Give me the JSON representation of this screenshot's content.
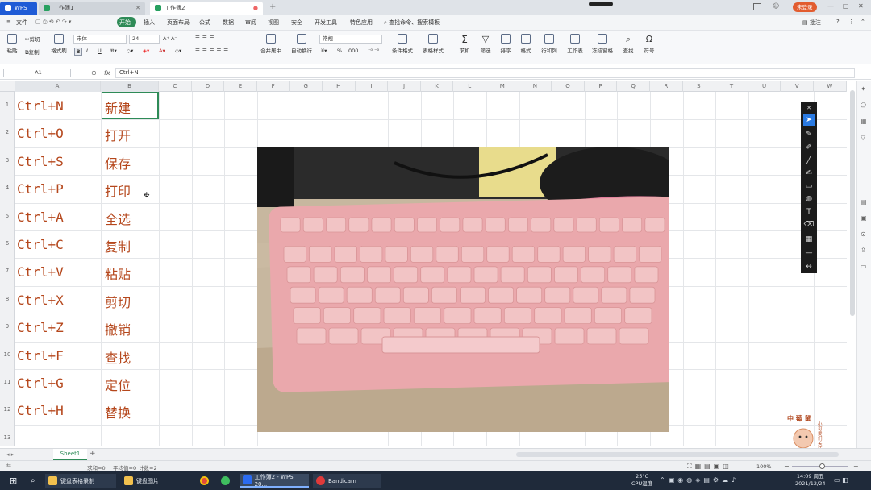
{
  "titlebar": {
    "app_tab": "WPS",
    "doc_tab1": "工作簿1",
    "doc_tab2": "工作簿2",
    "new_tab": "+",
    "unregistered": "未登录"
  },
  "menubar": {
    "file": "文件",
    "items": [
      "开始",
      "插入",
      "页面布局",
      "公式",
      "数据",
      "审阅",
      "视图",
      "安全",
      "开发工具",
      "特色应用"
    ],
    "search": "查找命令、搜索模板",
    "comment": "批注",
    "help": "?"
  },
  "ribbon": {
    "paste": "粘贴",
    "cut": "剪切",
    "copy": "复制",
    "format_painter": "格式刷",
    "font_name": "宋体",
    "font_size": "24",
    "bold": "B",
    "italic": "I",
    "underline": "U",
    "merge_center": "合并居中",
    "wrap": "自动换行",
    "number_format": "常规",
    "currency": "¥",
    "percent": "%",
    "thousands": "000",
    "cond_format": "条件格式",
    "table_style": "表格样式",
    "sum": "求和",
    "filter": "筛选",
    "sort": "排序",
    "format": "格式",
    "rowcol": "行和列",
    "worksheet": "工作表",
    "freeze": "冻结窗格",
    "find": "查找",
    "symbol": "符号"
  },
  "formulabar": {
    "name_box": "A1",
    "fx": "fx",
    "content": "Ctrl+N"
  },
  "columns": [
    "A",
    "B",
    "C",
    "D",
    "E",
    "F",
    "G",
    "H",
    "I",
    "J",
    "K",
    "L",
    "M",
    "N",
    "O",
    "P",
    "Q",
    "R",
    "S",
    "T",
    "U",
    "V",
    "W"
  ],
  "rows": [
    {
      "num": "1",
      "a": "Ctrl+N",
      "b": "新建"
    },
    {
      "num": "2",
      "a": "Ctrl+O",
      "b": "打开"
    },
    {
      "num": "3",
      "a": "Ctrl+S",
      "b": "保存"
    },
    {
      "num": "4",
      "a": "Ctrl+P",
      "b": "打印"
    },
    {
      "num": "5",
      "a": "Ctrl+A",
      "b": "全选"
    },
    {
      "num": "6",
      "a": "Ctrl+C",
      "b": "复制"
    },
    {
      "num": "7",
      "a": "Ctrl+V",
      "b": "粘贴"
    },
    {
      "num": "8",
      "a": "Ctrl+X",
      "b": "剪切"
    },
    {
      "num": "9",
      "a": "Ctrl+Z",
      "b": "撤销"
    },
    {
      "num": "10",
      "a": "Ctrl+F",
      "b": "查找"
    },
    {
      "num": "11",
      "a": "Ctrl+G",
      "b": "定位"
    },
    {
      "num": "12",
      "a": "Ctrl+H",
      "b": "替换"
    },
    {
      "num": "13",
      "a": "",
      "b": ""
    }
  ],
  "sheetbar": {
    "sheet": "Sheet1",
    "add": "+"
  },
  "statusbar": {
    "sum": "求和=0",
    "avg": "平均值=0",
    "count": "计数=2",
    "zoom": "100%"
  },
  "watermark": {
    "logo_text": "中 莓 鼠",
    "side_text": "小可爱们关注我"
  },
  "taskbar": {
    "app1": "键盘表格录制",
    "app2": "键盘图片",
    "app3": "工作簿2 - WPS 20...",
    "app4": "Bandicam",
    "temp": "25°C",
    "cpu": "CPU温度",
    "time": "14:09 周五",
    "date": "2021/12/24"
  },
  "colors": {
    "accent_green": "#2e8b57",
    "cell_text": "#b5471c",
    "keyboard_pink": "#e7a9ab",
    "taskbar": "#1f2a3a"
  }
}
